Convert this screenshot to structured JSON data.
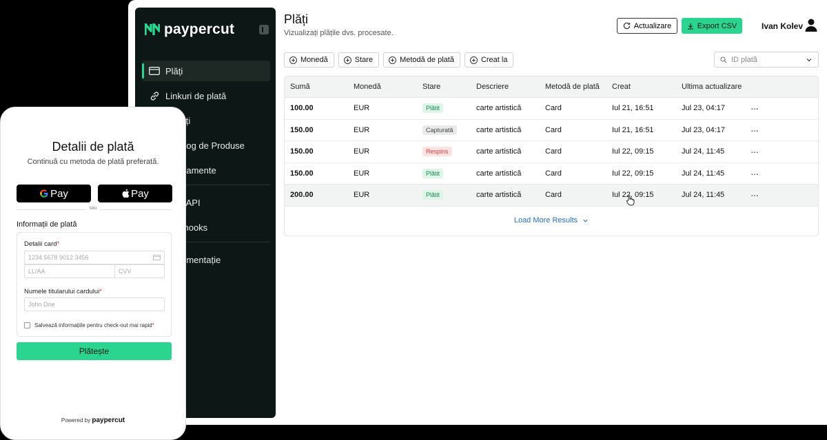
{
  "brand": {
    "name": "paypercut",
    "accent": "#2bd48f",
    "sidebar_bg": "#0d1715"
  },
  "sidebar": {
    "items": [
      {
        "label": "Plăți",
        "icon": "card-icon",
        "active": true
      },
      {
        "label": "Linkuri de plată",
        "icon": "link-icon",
        "active": false
      },
      {
        "label": "Clienți",
        "icon": "users-icon",
        "active": false
      },
      {
        "label": "Catalog de Produse",
        "icon": "catalog-icon",
        "active": false
      },
      {
        "label": "Abonamente",
        "icon": "refresh-icon",
        "active": false
      },
      {
        "label": "Chei API",
        "icon": "key-icon",
        "active": false
      },
      {
        "label": "Webhooks",
        "icon": "webhook-icon",
        "active": false
      },
      {
        "label": "Documentație",
        "icon": "doc-icon",
        "active": false
      }
    ]
  },
  "header": {
    "title": "Plăți",
    "subtitle": "Vizualizați plățile dvs. procesate.",
    "refresh_label": "Actualizare",
    "export_label": "Export CSV",
    "user_name": "Ivan Kolev"
  },
  "filters": [
    "Monedă",
    "Stare",
    "Metodă de plată",
    "Creat la"
  ],
  "search": {
    "placeholder": "ID plată"
  },
  "table": {
    "columns": [
      "Sumă",
      "Monedă",
      "Stare",
      "Descriere",
      "Metodă de plată",
      "Creat",
      "Ultima actualizare"
    ],
    "rows": [
      {
        "amount": "100.00",
        "currency": "EUR",
        "status": "Plătit",
        "status_kind": "paid",
        "desc": "carte artistică",
        "method": "Card",
        "created": "Iul 21, 16:51",
        "updated": "Jul 23, 04:17"
      },
      {
        "amount": "150.00",
        "currency": "EUR",
        "status": "Capturată",
        "status_kind": "captured",
        "desc": "carte artistică",
        "method": "Card",
        "created": "Iul 21, 16:51",
        "updated": "Jul 23, 04:17"
      },
      {
        "amount": "150.00",
        "currency": "EUR",
        "status": "Respins",
        "status_kind": "rejected",
        "desc": "carte artistică",
        "method": "Card",
        "created": "Iul 22, 09:15",
        "updated": "Jul 24, 11:45"
      },
      {
        "amount": "150.00",
        "currency": "EUR",
        "status": "Plătit",
        "status_kind": "paid",
        "desc": "carte artistică",
        "method": "Card",
        "created": "Iul 22, 09:15",
        "updated": "Jul 24, 11:45"
      },
      {
        "amount": "200.00",
        "currency": "EUR",
        "status": "Plătit",
        "status_kind": "paid",
        "desc": "carte artistică",
        "method": "Card",
        "created": "Iul 22, 09:15",
        "updated": "Jul 24, 11:45"
      }
    ],
    "row_menu": "···",
    "load_more": "Load More Results"
  },
  "checkout": {
    "title": "Detalii de plată",
    "subtitle": "Continuă cu metoda de plată preferată.",
    "gpay_label": "Pay",
    "apay_label": "Pay",
    "separator": "sau",
    "section_title": "Informații de plată",
    "card_label": "Detalii card",
    "card_placeholder": "1234 5678 9012 3456",
    "expiry_placeholder": "LL/AA",
    "cvv_placeholder": "CVV",
    "holder_label": "Numele titularului cardului",
    "holder_placeholder": "John Doe",
    "save_label": "Salvează informațiile pentru check-out mai rapid",
    "required_mark": "*",
    "pay_button": "Plătește",
    "powered_by": "Powered by",
    "powered_brand": "paypercut"
  }
}
